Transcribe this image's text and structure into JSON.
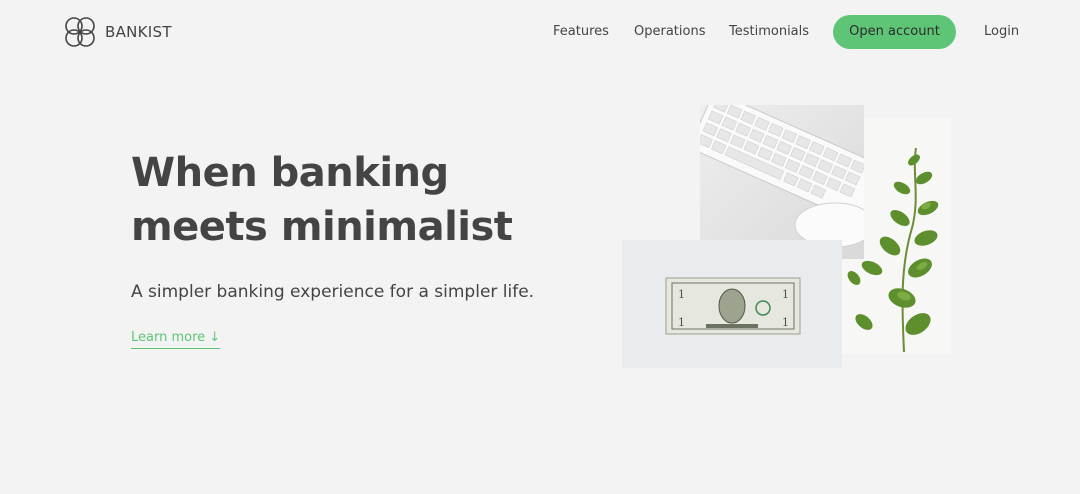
{
  "logo": {
    "text": "BANKIST",
    "icon": "bankist-logo-icon"
  },
  "nav": {
    "links": [
      {
        "label": "Features"
      },
      {
        "label": "Operations"
      },
      {
        "label": "Testimonials"
      }
    ],
    "open_account_label": "Open account",
    "login_label": "Login"
  },
  "hero": {
    "title_part1": "When",
    "title_highlight1": "banking",
    "title_part2": "meets",
    "title_highlight2": "minimalist",
    "subtitle": "A simpler banking experience for a simpler life.",
    "learn_more": "Learn more ↓"
  },
  "colors": {
    "background": "#f3f3f3",
    "accent": "#5ec576",
    "gradient_start": "#9be15d",
    "gradient_end": "#39b385",
    "text": "#444444"
  }
}
